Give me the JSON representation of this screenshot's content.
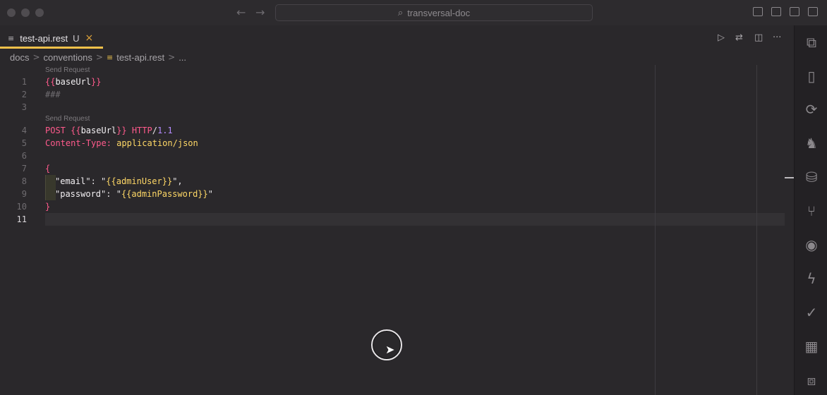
{
  "window": {
    "search_text": "transversal-doc",
    "back_icon": "←",
    "forward_icon": "→",
    "search_icon": "⌕"
  },
  "tab": {
    "file_icon": "≡",
    "label": "test-api.rest",
    "status": "U",
    "close_icon": "×"
  },
  "tab_actions": {
    "run_icon": "▷",
    "compare_icon": "⇄",
    "split_icon": "◫",
    "more_icon": "···"
  },
  "breadcrumb": {
    "items": [
      "docs",
      "conventions",
      "test-api.rest",
      "..."
    ],
    "separator": ">",
    "file_icon": "≡"
  },
  "editor": {
    "code_lens": [
      "Send Request",
      "Send Request"
    ],
    "line_numbers": [
      "1",
      "2",
      "3",
      "4",
      "5",
      "6",
      "7",
      "8",
      "9",
      "10",
      "11"
    ],
    "active_line": "11",
    "lines": {
      "l1": {
        "open": "{{",
        "var": "baseUrl",
        "close": "}}"
      },
      "l2": {
        "comment": "###"
      },
      "l4": {
        "method": "POST ",
        "open": "{{",
        "var": "baseUrl",
        "close": "}}",
        "proto": " HTTP",
        "slash": "/",
        "version": "1.1"
      },
      "l5": {
        "header": "Content-Type: ",
        "value": "application/json"
      },
      "l7": {
        "brace": "{"
      },
      "l8": {
        "q1": "\"",
        "key": "email",
        "q2": "\": \"",
        "val": "{{adminUser}}",
        "q3": "\","
      },
      "l9": {
        "q1": "\"",
        "key": "password",
        "q2": "\": \"",
        "val": "{{adminPassword}}",
        "q3": "\""
      },
      "l10": {
        "brace": "}"
      }
    }
  },
  "activity_bar": {
    "icons": [
      "⧉",
      "▯",
      "⟳",
      "♞",
      "⛁",
      "⑂",
      "◉",
      "ϟ",
      "✓",
      "▦",
      "⧈"
    ]
  },
  "cursor": {
    "arrow": "➤"
  }
}
